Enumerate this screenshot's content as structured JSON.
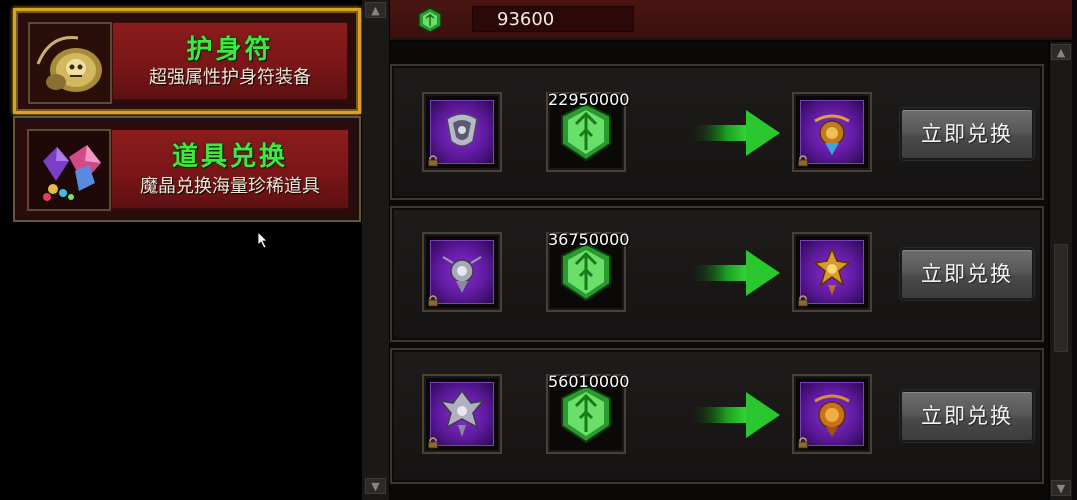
{
  "categories": [
    {
      "title": "护身符",
      "desc": "超强属性护身符装备",
      "selected": true,
      "icon": "amulet-icon"
    },
    {
      "title": "道具兑换",
      "desc": "魔晶兑换海量珍稀道具",
      "selected": false,
      "icon": "gems-icon"
    }
  ],
  "currency": {
    "icon": "green-crystal-icon",
    "value": "93600"
  },
  "offers": [
    {
      "cost": "22950000",
      "button": "立即兑换",
      "item_from": "silver-amulet-icon",
      "item_to": "gold-amulet-icon"
    },
    {
      "cost": "36750000",
      "button": "立即兑换",
      "item_from": "silver-amulet-icon",
      "item_to": "gold-amulet-icon"
    },
    {
      "cost": "56010000",
      "button": "立即兑换",
      "item_from": "silver-amulet-icon",
      "item_to": "gold-amulet-icon"
    }
  ],
  "colors": {
    "title_green": "#3dea3d",
    "selected_border": "#d9a520",
    "banner_red": "#7a1618",
    "slot_purple": "#6a1fb0",
    "arrow_green": "#22c02a"
  }
}
